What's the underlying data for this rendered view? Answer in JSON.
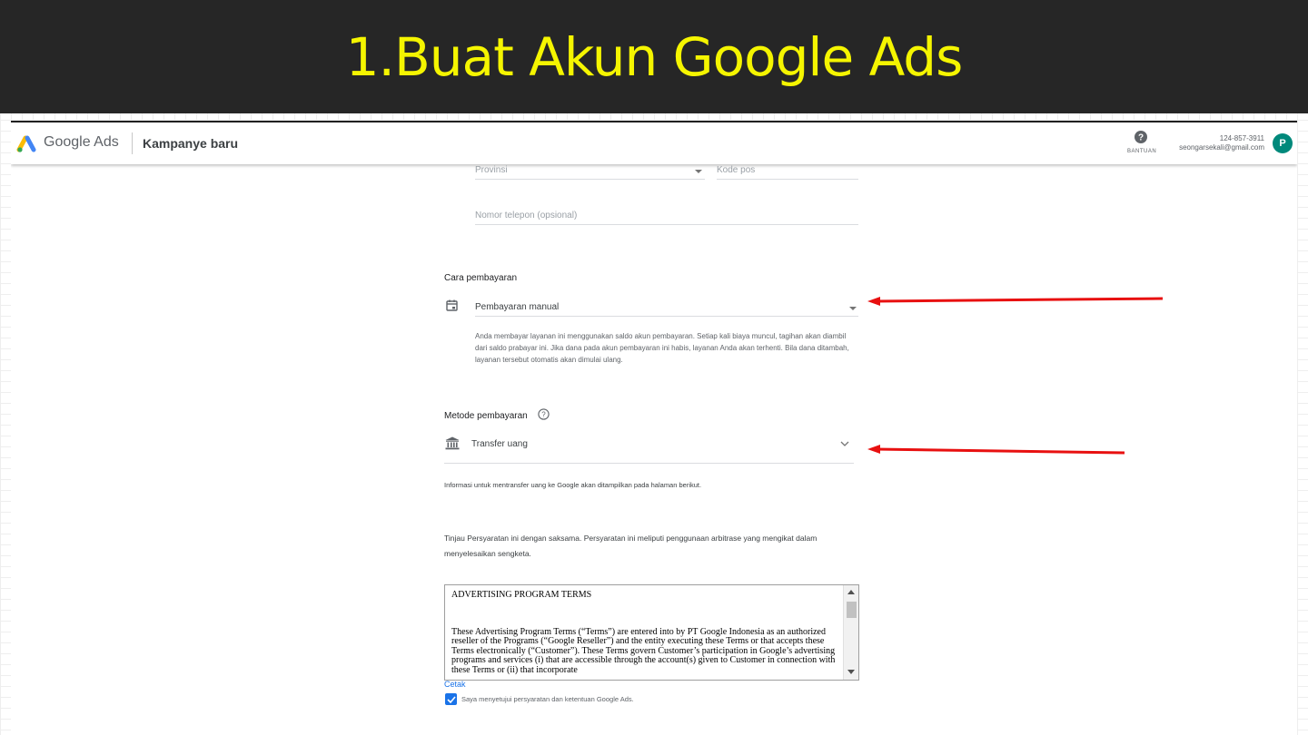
{
  "slide": {
    "title": "1.Buat Akun Google Ads"
  },
  "appbar": {
    "brand_google": "Google",
    "brand_ads": "Ads",
    "page_title": "Kampanye baru",
    "help_label": "BANTUAN",
    "account_id": "124-857-3911",
    "account_email": "seongarsekali@gmail.com",
    "avatar_letter": "P"
  },
  "address": {
    "province_placeholder": "Provinsi",
    "postal_placeholder": "Kode pos",
    "phone_placeholder": "Nomor telepon (opsional)"
  },
  "payment_type": {
    "label": "Cara pembayaran",
    "value": "Pembayaran manual",
    "description": "Anda membayar layanan ini menggunakan saldo akun pembayaran. Setiap kali biaya muncul, tagihan akan diambil dari saldo prabayar ini. Jika dana pada akun pembayaran ini habis, layanan Anda akan terhenti. Bila dana ditambah, layanan tersebut otomatis akan dimulai ulang."
  },
  "payment_method": {
    "label": "Metode pembayaran",
    "value": "Transfer uang",
    "info": "Informasi untuk mentransfer uang ke Google akan ditampilkan pada halaman berikut."
  },
  "terms": {
    "intro": "Tinjau Persyaratan ini dengan saksama. Persyaratan ini meliputi penggunaan arbitrase yang mengikat dalam menyelesaikan sengketa.",
    "heading": "ADVERTISING PROGRAM TERMS",
    "body": "These Advertising Program Terms (“Terms”) are entered into by PT Google Indonesia as an authorized reseller of the Programs (“Google Reseller”) and the entity executing these Terms or that accepts these Terms electronically (“Customer”).  These Terms govern Customer’s participation in Google’s advertising programs and services (i) that are accessible through the account(s) given to Customer in connection with these Terms or (ii) that incorporate",
    "print_link": "Cetak",
    "agree_label": "Saya menyetujui persyaratan dan ketentuan Google Ads.",
    "agree_checked": true
  },
  "colors": {
    "title_bar_bg": "#262626",
    "title_text": "#f5f500",
    "annotation_arrow": "#e81010",
    "accent_blue": "#1a73e8",
    "avatar_bg": "#00897b"
  }
}
